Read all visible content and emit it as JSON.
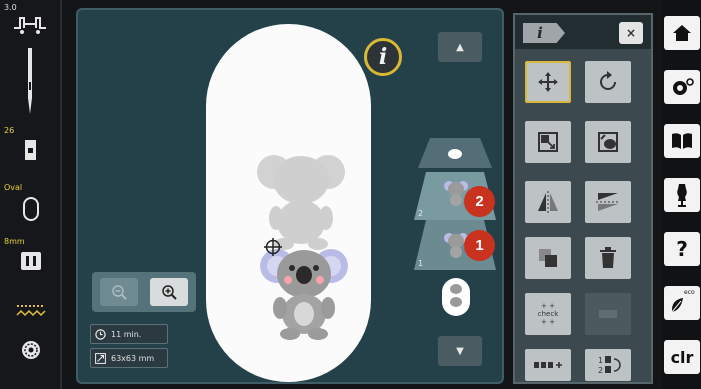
{
  "status": {
    "version": "3.0",
    "stitch_number": "26",
    "hoop_name": "Oval",
    "needle_size": "8mm"
  },
  "workspace": {
    "info_label": "i",
    "time_estimate": "11 min.",
    "design_size": "63x63 mm",
    "layer_badges": [
      "2",
      "1"
    ]
  },
  "tool_panel": {
    "tab_label": "i",
    "close_label": "×",
    "check_label_top": "+ +",
    "check_label": "check",
    "check_label_bottom": "+ +",
    "tools": [
      "move",
      "rotate",
      "scale",
      "resize-frame",
      "mirror-horizontal",
      "mirror-vertical",
      "duplicate",
      "delete",
      "check-position",
      "disabled",
      "add-combination",
      "stitch-order"
    ]
  },
  "nav": {
    "clr_label": "clr",
    "eco_label": "eco",
    "help_label": "?"
  },
  "colors": {
    "accent_yellow": "#d9b93a",
    "badge_red": "#c8321e",
    "stage_teal": "#244049"
  }
}
